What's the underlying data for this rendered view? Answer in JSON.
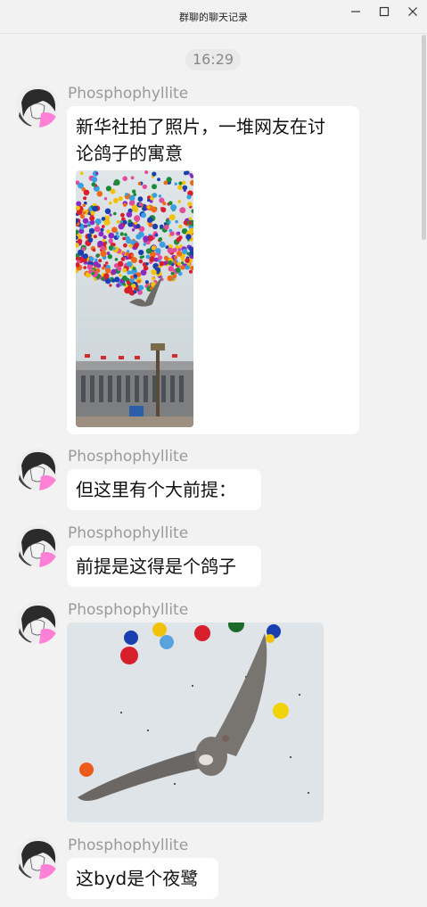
{
  "window": {
    "title": "群聊的聊天记录",
    "minimize_icon": "minimize-icon",
    "maximize_icon": "maximize-icon",
    "close_icon": "close-icon"
  },
  "chat": {
    "timestamp": "16:29",
    "messages": [
      {
        "sender": "Phosphophyllite",
        "text_lines": [
          "新华社拍了照片，一堆网友在讨",
          "论鸽子的寓意"
        ],
        "has_image": true,
        "image_desc_icon": "photo-balloons-pigeon-building"
      },
      {
        "sender": "Phosphophyllite",
        "text": "但这里有个大前提："
      },
      {
        "sender": "Phosphophyllite",
        "text": "前提是这得是个鸽子"
      },
      {
        "sender": "Phosphophyllite",
        "has_image": true,
        "image_desc_icon": "photo-bird-closeup-balloons"
      },
      {
        "sender": "Phosphophyllite",
        "text": "这byd是个夜鹭"
      }
    ]
  },
  "colors": {
    "background": "#f2f2f2",
    "bubble": "#ffffff",
    "sender_text": "#9a9a9a",
    "message_text": "#111111",
    "avatar_accent": "#ff80d5"
  }
}
